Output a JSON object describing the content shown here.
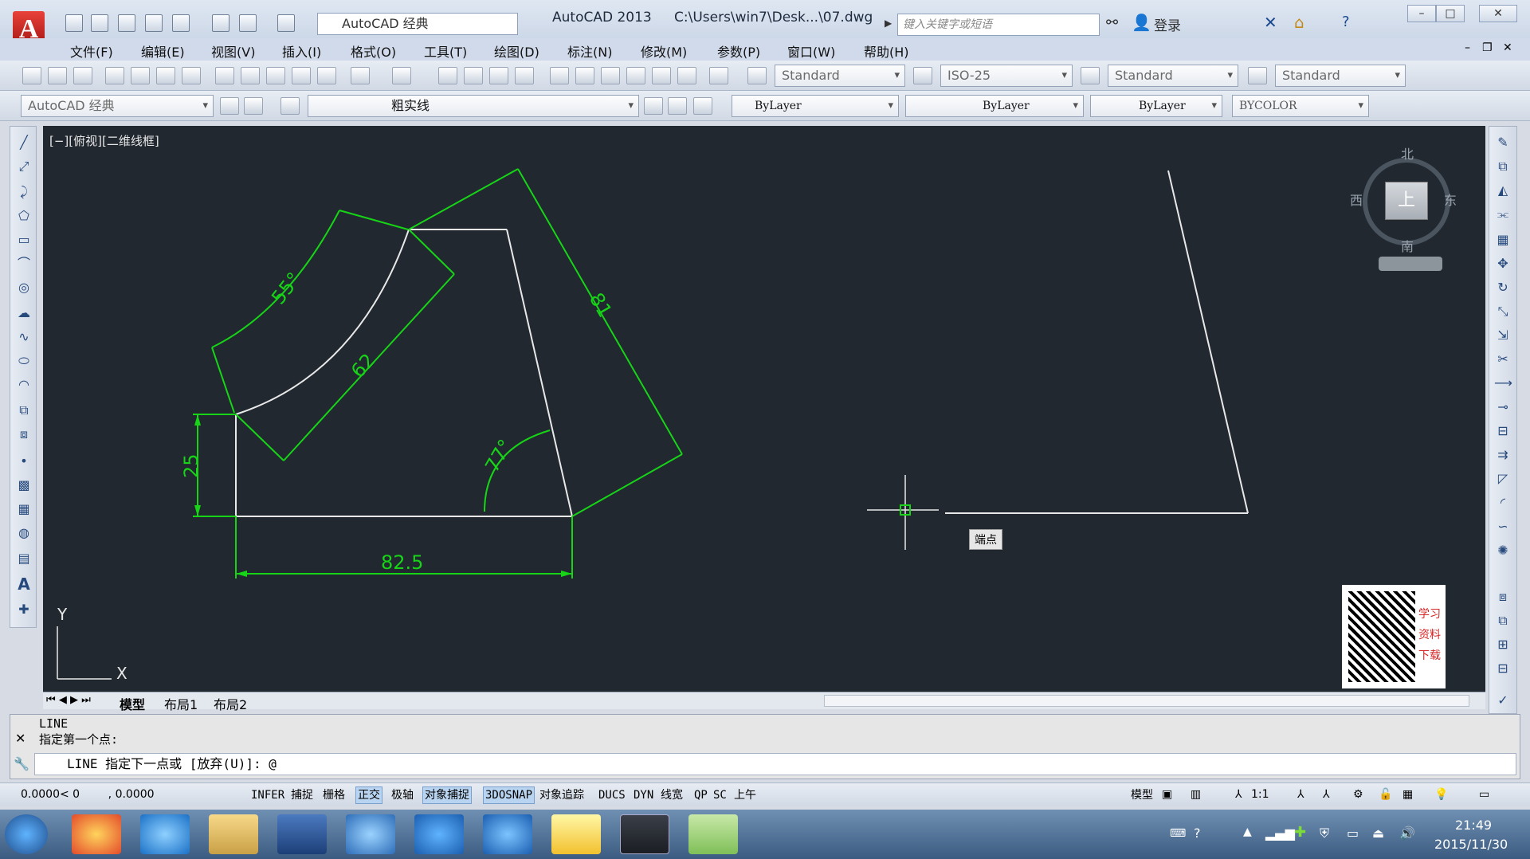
{
  "title": {
    "app": "AutoCAD 2013",
    "path": "C:\\Users\\win7\\Desk...\\07.dwg",
    "workspace": "AutoCAD 经典",
    "search_placeholder": "键入关键字或短语",
    "login": "登录"
  },
  "menu": [
    "文件(F)",
    "编辑(E)",
    "视图(V)",
    "插入(I)",
    "格式(O)",
    "工具(T)",
    "绘图(D)",
    "标注(N)",
    "修改(M)",
    "参数(P)",
    "窗口(W)",
    "帮助(H)"
  ],
  "toolbar": {
    "text_style": "Standard",
    "dim_style": "ISO-25",
    "table_style": "Standard",
    "mleader_style": "Standard",
    "workspace": "AutoCAD 经典",
    "layer": "粗实线",
    "color": "ByLayer",
    "linetype": "ByLayer",
    "lineweight": "ByLayer",
    "plotstyle": "BYCOLOR"
  },
  "viewport": {
    "label": "[−][俯视][二维线框]",
    "compass": {
      "north": "北",
      "south": "南",
      "east": "东",
      "west": "西",
      "face": "上"
    },
    "tooltip": "端点"
  },
  "dimensions": {
    "arc_angle": "55°",
    "arc_length": "62",
    "side_length": "81",
    "height": "25",
    "angle": "77°",
    "base": "82.5"
  },
  "ucs": {
    "x": "X",
    "y": "Y"
  },
  "watermark": {
    "text": "学习资料下载"
  },
  "tabs": [
    "模型",
    "布局1",
    "布局2"
  ],
  "command": {
    "history_1": "LINE",
    "history_2": "指定第一个点:",
    "prompt": "LINE 指定下一点或 [放弃(U)]: @"
  },
  "status": {
    "coords": "0.0000< 0        , 0.0000",
    "toggles": [
      {
        "label": "INFER",
        "on": false
      },
      {
        "label": "捕捉",
        "on": false
      },
      {
        "label": "栅格",
        "on": false
      },
      {
        "label": "正交",
        "on": true
      },
      {
        "label": "极轴",
        "on": false
      },
      {
        "label": "对象捕捉",
        "on": true
      },
      {
        "label": "3DOSNAP",
        "on": true
      },
      {
        "label": "对象追踪",
        "on": false
      },
      {
        "label": "DUCS",
        "on": false
      },
      {
        "label": "DYN",
        "on": false
      },
      {
        "label": "线宽",
        "on": false
      },
      {
        "label": "QP",
        "on": false
      },
      {
        "label": "SC",
        "on": false
      },
      {
        "label": "上午",
        "on": false
      }
    ],
    "model": "模型",
    "scale": "1:1"
  },
  "clock": {
    "time": "21:49",
    "date": "2015/11/30"
  },
  "colors": {
    "dim": "#17d417",
    "geometry": "#e8e8e8",
    "canvas": "#212830"
  }
}
